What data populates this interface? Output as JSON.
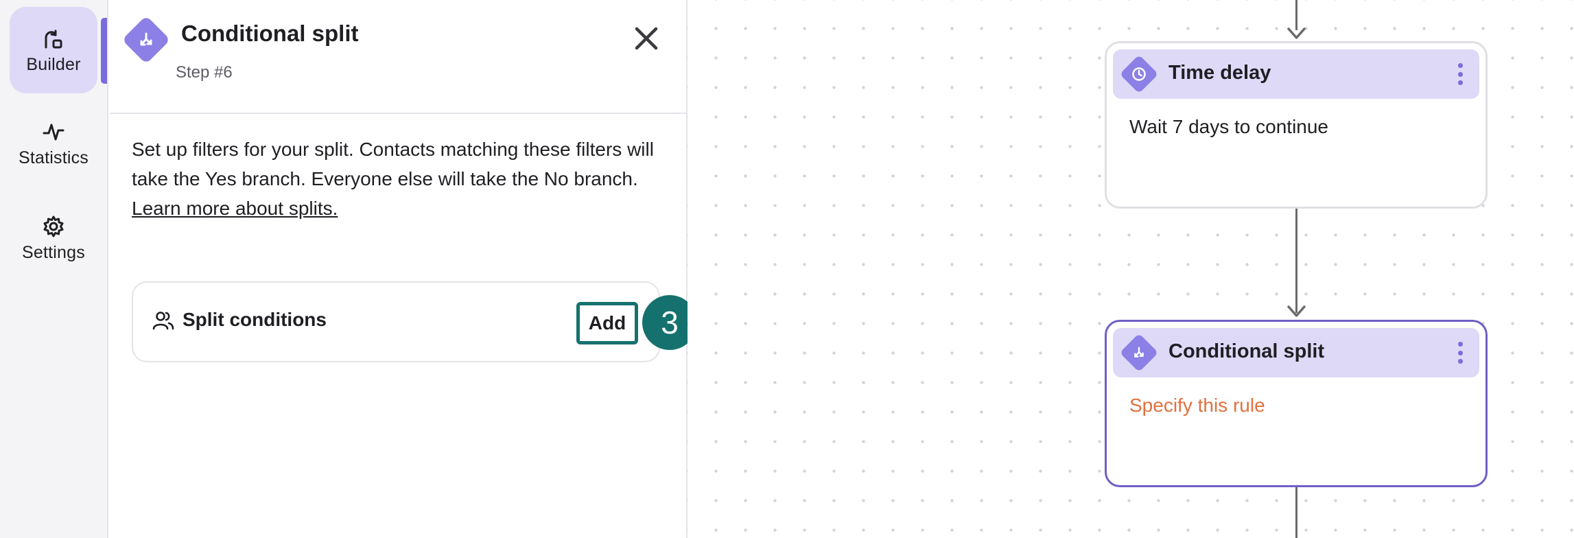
{
  "rail": {
    "items": [
      {
        "label": "Builder",
        "icon": "builder-icon",
        "active": true
      },
      {
        "label": "Statistics",
        "icon": "statistics-icon",
        "active": false
      },
      {
        "label": "Settings",
        "icon": "gear-icon",
        "active": false
      }
    ]
  },
  "panel": {
    "title": "Conditional split",
    "step": "Step #6",
    "description": "Set up filters for your split. Contacts matching these filters will take the Yes branch. Everyone else will take the No branch.",
    "learn_more": "Learn more about splits.",
    "conditions_label": "Split conditions",
    "add_label": "Add",
    "badge": "3"
  },
  "canvas": {
    "nodes": [
      {
        "title": "Time delay",
        "description": "Wait 7 days to continue",
        "icon": "clock-icon"
      },
      {
        "title": "Conditional split",
        "description": "Specify this rule",
        "icon": "split-icon"
      }
    ]
  },
  "colors": {
    "accent": "#7a6cdc",
    "node_head": "#ddd9f7",
    "badge": "#15716e",
    "warning_text": "#e0703e",
    "selected_border": "#6e5fc6"
  }
}
